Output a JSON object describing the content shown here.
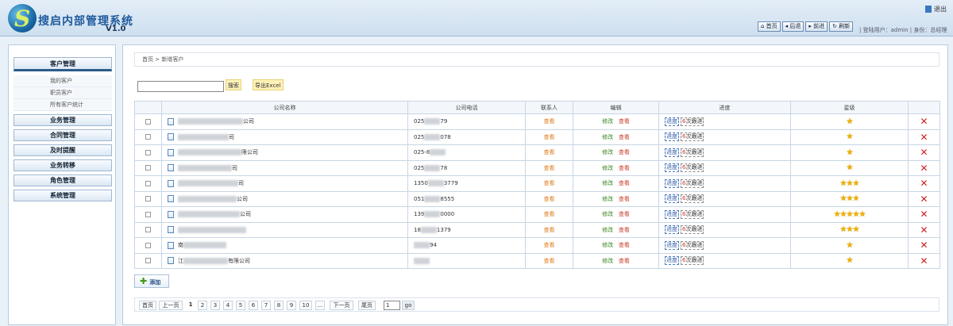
{
  "app": {
    "title": "搜启内部管理系统",
    "version": "V1.0",
    "logo_letter": "S"
  },
  "header": {
    "exit_label": "退出",
    "toolbar": [
      "首页",
      "后退",
      "前进",
      "刷新"
    ],
    "user_info": "| 登陆用户：admin | 身份：总经理"
  },
  "sidebar": {
    "active_menu": "客户管理",
    "sub_items": [
      "我的客户",
      "职员客户",
      "所有客户统计"
    ],
    "menus": [
      "业务管理",
      "合同管理",
      "及时提醒",
      "业务转移",
      "角色管理",
      "系统管理"
    ]
  },
  "breadcrumb": "首页 > 新增客户",
  "search": {
    "button": "搜索",
    "export": "导出Excel",
    "value": ""
  },
  "table": {
    "headers": [
      "公司名称",
      "公司电话",
      "联系人",
      "编辑",
      "进度",
      "星级"
    ],
    "view_label": "查看",
    "edit_label": "修改",
    "progress_label": "进度",
    "follow_label": "次跟进",
    "rows": [
      {
        "name_prefix": "",
        "name_suffix": "公司",
        "phone_prefix": "025",
        "phone_suffix": "79",
        "follow_count": "6",
        "stars": 1
      },
      {
        "name_prefix": "",
        "name_suffix": "司",
        "phone_prefix": "025",
        "phone_suffix": "078",
        "follow_count": "6",
        "stars": 1
      },
      {
        "name_prefix": "",
        "name_suffix": "限公司",
        "phone_prefix": "025-8",
        "phone_suffix": "",
        "follow_count": "6",
        "stars": 1
      },
      {
        "name_prefix": "",
        "name_suffix": "司",
        "phone_prefix": "025",
        "phone_suffix": "78",
        "follow_count": "6",
        "stars": 1
      },
      {
        "name_prefix": "",
        "name_suffix": "司",
        "phone_prefix": "1350",
        "phone_suffix": "3779",
        "follow_count": "6",
        "stars": 3
      },
      {
        "name_prefix": "",
        "name_suffix": "公司",
        "phone_prefix": "051",
        "phone_suffix": "8555",
        "follow_count": "6",
        "stars": 3
      },
      {
        "name_prefix": "",
        "name_suffix": "公司",
        "phone_prefix": "139",
        "phone_suffix": "0000",
        "follow_count": "6",
        "stars": 5
      },
      {
        "name_prefix": "",
        "name_suffix": "",
        "phone_prefix": "18",
        "phone_suffix": "1379",
        "follow_count": "6",
        "stars": 3
      },
      {
        "name_prefix": "南",
        "name_suffix": "",
        "phone_prefix": "",
        "phone_suffix": "94",
        "follow_count": "6",
        "stars": 1
      },
      {
        "name_prefix": "江",
        "name_suffix": "有限公司",
        "phone_prefix": "",
        "phone_suffix": "",
        "follow_count": "6",
        "stars": 1
      }
    ]
  },
  "add_button": "添加",
  "pager": {
    "first": "首页",
    "prev": "上一页",
    "pages": [
      "1",
      "2",
      "3",
      "4",
      "5",
      "6",
      "7",
      "8",
      "9",
      "10",
      "..."
    ],
    "current": "1",
    "next": "下一页",
    "last": "尾页",
    "jump_value": "1",
    "go": "go"
  }
}
